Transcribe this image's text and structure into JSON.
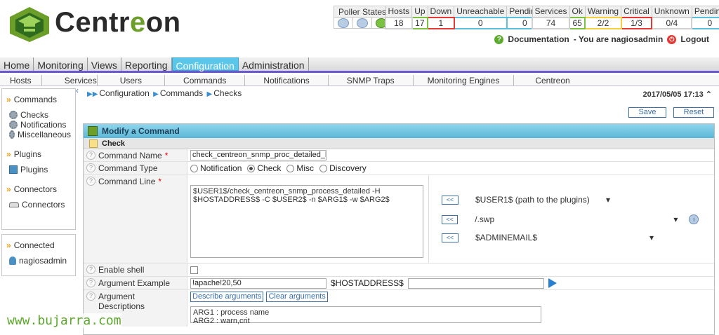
{
  "brand": {
    "name_dark": "Centr",
    "name_accent": "e",
    "name_end": "on"
  },
  "poller": {
    "label": "Poller States"
  },
  "hosts_stats": {
    "headers": [
      "Hosts",
      "Up",
      "Down",
      "Unreachable",
      "Pending"
    ],
    "values": [
      "18",
      "17",
      "1",
      "0",
      "0"
    ]
  },
  "services_stats": {
    "headers": [
      "Services",
      "Ok",
      "Warning",
      "Critical",
      "Unknown",
      "Pending"
    ],
    "values": [
      "74",
      "65",
      "2/2",
      "1/3",
      "0/4",
      "0"
    ]
  },
  "toplinks": {
    "documentation": "Documentation",
    "user_text": "- You are nagiosadmin",
    "logout": "Logout"
  },
  "main_menu": [
    "Home",
    "Monitoring",
    "Views",
    "Reporting",
    "Configuration",
    "Administration"
  ],
  "sub_menu": [
    "Hosts",
    "Services",
    "Users",
    "Commands",
    "Notifications",
    "SNMP  Traps",
    "Monitoring  Engines",
    "Centreon"
  ],
  "sidebar": {
    "commands_header": "Commands",
    "commands_items": [
      "Checks",
      "Notifications",
      "Miscellaneous"
    ],
    "plugins_header": "Plugins",
    "plugins_item": "Plugins",
    "connectors_header": "Connectors",
    "connectors_item": "Connectors",
    "connected_header": "Connected",
    "connected_user": "nagiosadmin"
  },
  "breadcrumb": [
    "Configuration",
    "Commands",
    "Checks"
  ],
  "datetime": "2017/05/05 17:13",
  "buttons": {
    "save": "Save",
    "reset": "Reset"
  },
  "form": {
    "title": "Modify a Command",
    "section": "Check",
    "command_name_label": "Command Name",
    "command_name_value": "check_centreon_snmp_proc_detailed_buer",
    "command_type_label": "Command Type",
    "command_types": [
      "Notification",
      "Check",
      "Misc",
      "Discovery"
    ],
    "command_line_label": "Command Line",
    "command_line_value": "$USER1$/check_centreon_snmp_process_detailed -H\n$HOSTADDRESS$ -C $USER2$ -n $ARG1$ -w $ARG2$",
    "macro_button": "<<",
    "macro_1": "$USER1$ (path to the plugins)",
    "macro_2": "/.swp",
    "macro_3": "$ADMINEMAIL$",
    "enable_shell_label": "Enable shell",
    "argument_example_label": "Argument Example",
    "argument_example_value": "!apache!20,50",
    "hostaddress_label": "$HOSTADDRESS$",
    "argument_desc_label": "Argument Descriptions",
    "describe_btn": "Describe arguments",
    "clear_btn": "Clear arguments",
    "argument_desc_value": "ARG1 : process name\nARG2 : warn,crit"
  },
  "watermark": "www.bujarra.com"
}
